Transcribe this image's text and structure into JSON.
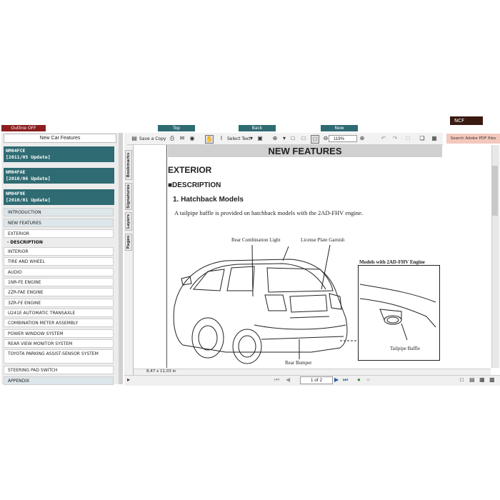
{
  "topbar": {
    "outline_label": "Outline OFF",
    "top_label": "Top",
    "back_label": "Back",
    "new_label": "New",
    "ncf_label": "NCF"
  },
  "left": {
    "title": "New Car Features",
    "docs": [
      {
        "code": "NM04FCE",
        "update": "[2011/05 Update]"
      },
      {
        "code": "NM04FAE",
        "update": "[2010/06 Update]"
      },
      {
        "code": "NM04F9E",
        "update": "[2010/01 Update]"
      }
    ],
    "items": [
      "INTRODUCTION",
      "NEW FEATURES",
      "EXTERIOR",
      "· DESCRIPTION",
      "INTERIOR",
      "TIRE AND WHEEL",
      "AUDIO",
      "1NR-FE ENGINE",
      "2ZR-FAE ENGINE",
      "3ZR-FE ENGINE",
      "U241E AUTOMATIC TRANSAXLE",
      "COMBINATION METER ASSEMBLY",
      "POWER WINDOW SYSTEM",
      "REAR VIEW MONITOR SYSTEM",
      "TOYOTA PARKING ASSIST-SENSOR SYSTEM",
      "STEERING PAD SWITCH",
      "APPENDIX"
    ]
  },
  "vtabs": [
    "Bookmarks",
    "Signatures",
    "Layers",
    "Pages"
  ],
  "toolbar": {
    "save_copy": "Save a Copy",
    "select_text": "Select Text",
    "zoom": "119%",
    "search_adobe": "Search Adobe PDF files"
  },
  "doc": {
    "header": "NEW FEATURES",
    "section": "EXTERIOR",
    "subsection": "■DESCRIPTION",
    "heading": "1.  Hatchback Models",
    "body": "A tailpipe baffle is provided on hatchback models with the 2AD-FHV engine.",
    "callouts": {
      "rear_combination_light": "Rear Combination Light",
      "license_plate_garnish": "License Plate Garnish",
      "rear_bumper": "Rear Bumper",
      "inset_title": "Models with 2AD-FHV Engine",
      "tailpipe_baffle": "Tailpipe Baffle"
    }
  },
  "status": {
    "page_size": "8,47 x 11,03 in",
    "page_indicator": "1 of 2"
  }
}
